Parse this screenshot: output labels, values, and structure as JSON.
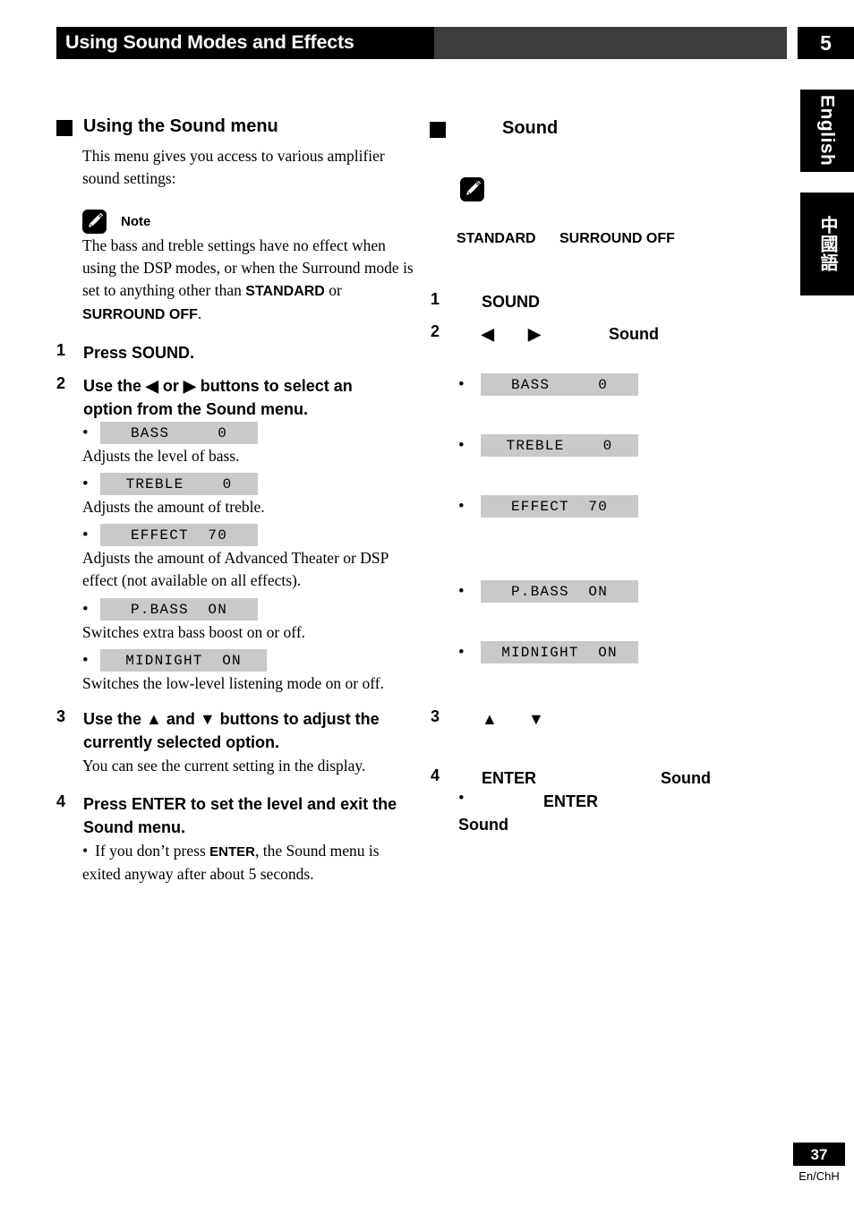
{
  "header": {
    "chapter_title": "Using Sound Modes and Effects",
    "chapter_number": "5"
  },
  "side_tabs": [
    {
      "label": "English"
    },
    {
      "label": "中國語"
    }
  ],
  "left_column": {
    "section_title": "Using the Sound menu",
    "intro": "This menu gives you access to various amplifier sound settings:",
    "note": {
      "label": "Note",
      "text_part1": "The bass and treble settings have no effect when using the DSP modes, or when the Surround mode is set to anything other than ",
      "bold1": "STANDARD",
      "text_part2": " or ",
      "bold2": "SURROUND OFF",
      "text_part3": "."
    },
    "steps": [
      {
        "num": "1",
        "text": "Press SOUND."
      },
      {
        "num": "2",
        "text": "Use the ◀ or ▶ buttons to select an option from the Sound menu."
      },
      {
        "num": "3",
        "text": "Use the ▲ and ▼ buttons to adjust the currently selected option."
      },
      {
        "num": "4",
        "text": "Press ENTER to set the level and exit the Sound menu."
      }
    ],
    "step2_options": [
      {
        "bullet": "•",
        "lcd": "BASS     0",
        "desc": "Adjusts the level of bass."
      },
      {
        "bullet": "•",
        "lcd": "TREBLE    0",
        "desc": "Adjusts the amount of treble."
      },
      {
        "bullet": "•",
        "lcd": "EFFECT  70",
        "desc": "Adjusts the amount of Advanced Theater or DSP effect (not available on all effects)."
      },
      {
        "bullet": "•",
        "lcd": "P.BASS  ON",
        "desc": "Switches extra bass boost on or off."
      },
      {
        "bullet": "•",
        "lcd": "MIDNIGHT  ON",
        "desc": "Switches the low-level listening mode on or off."
      }
    ],
    "step3_desc": "You can see the current setting in the display.",
    "step4_note": {
      "bullet": "•",
      "pre": "If you don’t press ",
      "bold": "ENTER",
      "post": ", the Sound menu is exited anyway after about 5 seconds."
    }
  },
  "right_column": {
    "section_title": "Sound",
    "note_inline_terms": {
      "term1": "STANDARD",
      "term2": "SURROUND OFF"
    },
    "steps": [
      {
        "num": "1",
        "text": "SOUND"
      },
      {
        "num": "2",
        "arrow_left": "◀",
        "arrow_right": "▶",
        "text": "Sound"
      },
      {
        "num": "3",
        "arrow_up": "▲",
        "arrow_down": "▼"
      },
      {
        "num": "4",
        "text": "ENTER",
        "text2": "Sound"
      }
    ],
    "step4_note": {
      "bullet": "•",
      "term": "ENTER",
      "term2": "Sound"
    },
    "options": [
      {
        "bullet": "•",
        "lcd": "BASS     0"
      },
      {
        "bullet": "•",
        "lcd": "TREBLE    0"
      },
      {
        "bullet": "•",
        "lcd": "EFFECT  70"
      },
      {
        "bullet": "•",
        "lcd": "P.BASS  ON"
      },
      {
        "bullet": "•",
        "lcd": "MIDNIGHT  ON"
      }
    ]
  },
  "footer": {
    "page_number": "37",
    "code": "En/ChH"
  },
  "colors": {
    "header_black": "#000000",
    "header_grey": "#3d3d3d",
    "lcd_grey": "#c9c9c9",
    "text": "#000000"
  }
}
